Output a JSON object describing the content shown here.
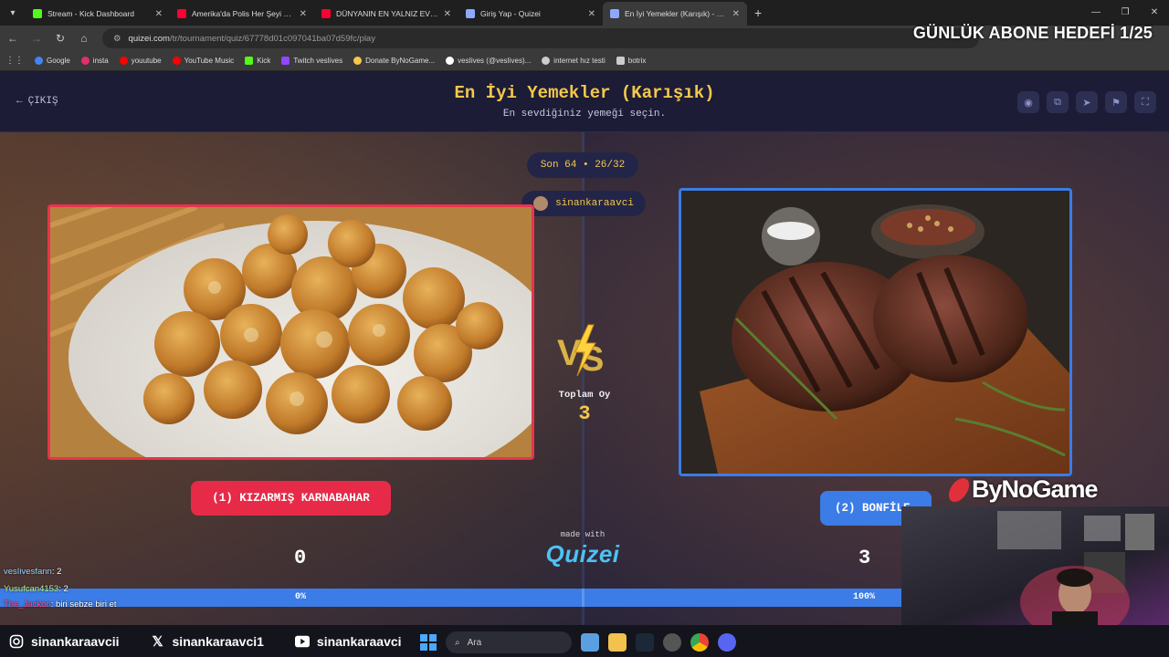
{
  "browser": {
    "tabs": [
      {
        "title": "Stream - Kick Dashboard",
        "color": "#53fc18",
        "active": false
      },
      {
        "title": "Amerika'da Polis Her Şeyi Görü",
        "color": "#ff0033",
        "active": false
      },
      {
        "title": "DÜNYANIN EN YALNIZ EVİNDE",
        "color": "#ff0033",
        "active": false
      },
      {
        "title": "Giriş Yap - Quizei",
        "color": "#8fa8ff",
        "active": false
      },
      {
        "title": "En İyi Yemekler (Karışık) - Tier L",
        "color": "#8fa8ff",
        "active": true
      }
    ],
    "url_host": "quizei.com",
    "url_path": "/tr/tournament/quiz/67778d01c097041ba07d59fc/play",
    "bookmarks": [
      {
        "label": "Google",
        "color": "#4285f4"
      },
      {
        "label": "insta",
        "color": "#e1306c"
      },
      {
        "label": "youutube",
        "color": "#ff0000"
      },
      {
        "label": "YouTube Music",
        "color": "#ff0000"
      },
      {
        "label": "Kick",
        "color": "#53fc18"
      },
      {
        "label": "Twitch vesIives",
        "color": "#9146ff"
      },
      {
        "label": "Donate ByNoGame...",
        "color": "#f5c84a"
      },
      {
        "label": "vesIives (@vesIives)...",
        "color": "#ffffff"
      },
      {
        "label": "internet hız testi",
        "color": "#cccccc"
      },
      {
        "label": "botrix",
        "color": "#cccccc"
      }
    ]
  },
  "overlay": {
    "goal_text": "GÜNLÜK ABONE HEDEFİ 1/25",
    "brand": "ByNoGame"
  },
  "quiz": {
    "exit_label": "ÇIKIŞ",
    "title": "En İyi Yemekler (Karışık)",
    "subtitle": "En sevdiğiniz yemeği seçin.",
    "round": "Son 64 • 26/32",
    "username": "sinankaraavci",
    "total_label": "Toplam Oy",
    "total_value": "3",
    "left_choice": "(1) KIZARMIŞ KARNABAHAR",
    "right_choice": "(2) BONFİLE",
    "left_score": "0",
    "right_score": "3",
    "left_percent": "0%",
    "right_percent": "100%",
    "right_fraction": 1.0,
    "made_with": "made with",
    "brand": "Quizei"
  },
  "chat": [
    {
      "user": "vesIivesfann",
      "text": ": 2"
    },
    {
      "user": "Yusufcan4153",
      "text": ": 2"
    },
    {
      "user": "The_Jackon",
      "text": ": biri sebze biri et"
    }
  ],
  "socials": {
    "instagram": "sinankaraavcii",
    "x": "sinankaraavci1",
    "youtube": "sinankaraavci"
  },
  "taskbar": {
    "search_placeholder": "Ara"
  }
}
